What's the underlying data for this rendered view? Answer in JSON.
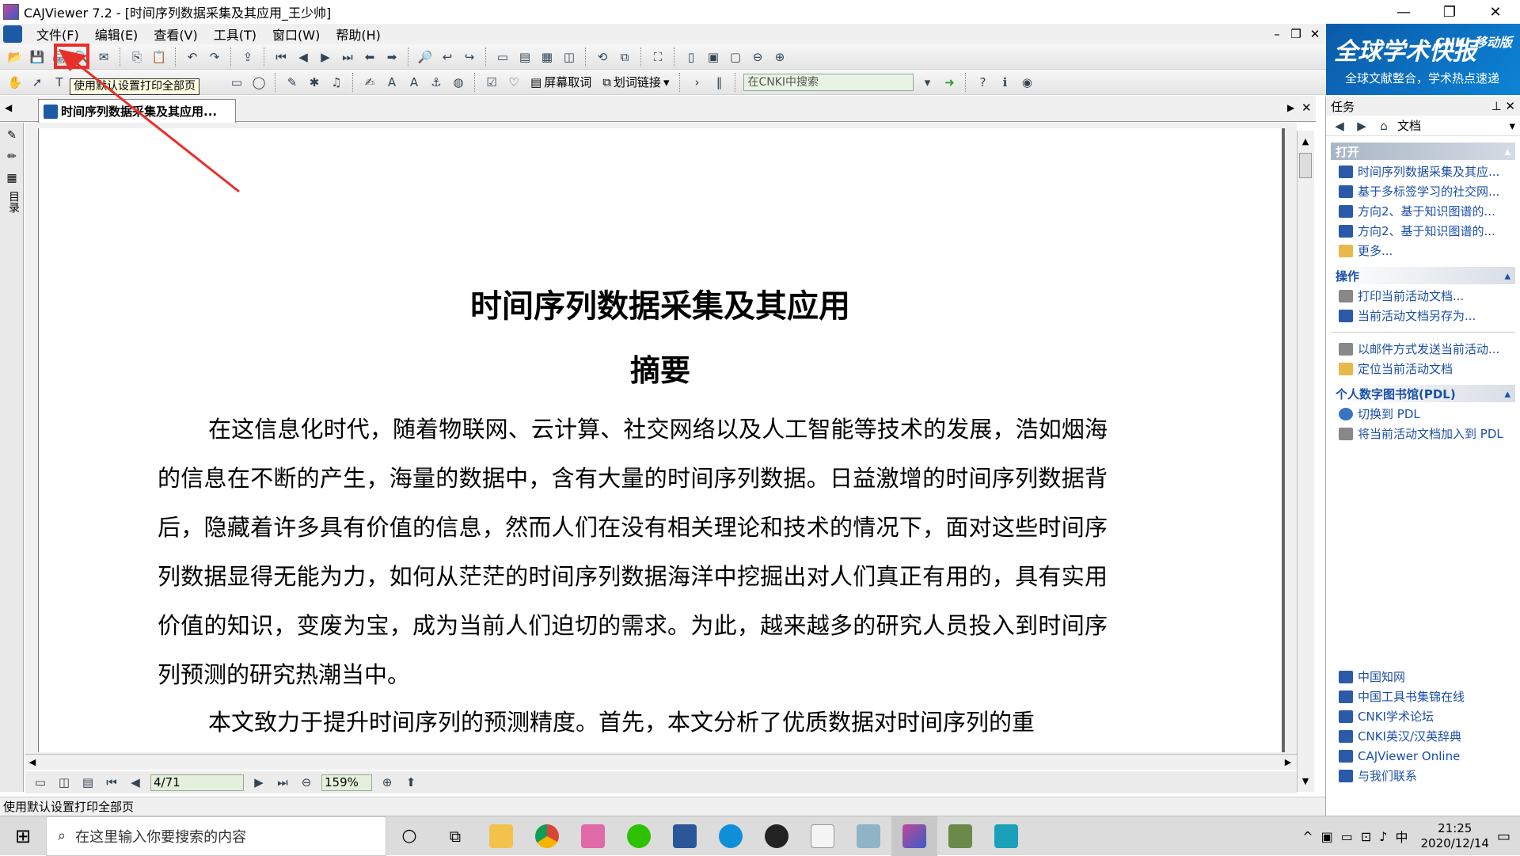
{
  "window": {
    "title": "CAJViewer 7.2 - [时间序列数据采集及其应用_王少帅]",
    "controls": {
      "minimize": "—",
      "restore": "❐",
      "close": "✕"
    }
  },
  "menu": [
    "文件(F)",
    "编辑(E)",
    "查看(V)",
    "工具(T)",
    "窗口(W)",
    "帮助(H)"
  ],
  "toolbar": {
    "tooltip": "使用默认设置打印全部页",
    "screen_select": "屏幕取词",
    "word_link": "划词链接",
    "search_placeholder": "在CNKI中搜索"
  },
  "tab": {
    "label": "时间序列数据采集及其应用..."
  },
  "left_panel": {
    "toc_label": "目录"
  },
  "document": {
    "title": "时间序列数据采集及其应用",
    "subtitle": "摘要",
    "paragraph1": "在这信息化时代，随着物联网、云计算、社交网络以及人工智能等技术的发展，浩如烟海的信息在不断的产生，海量的数据中，含有大量的时间序列数据。日益激增的时间序列数据背后，隐藏着许多具有价值的信息，然而人们在没有相关理论和技术的情况下，面对这些时间序列数据显得无能为力，如何从茫茫的时间序列数据海洋中挖掘出对人们真正有用的，具有实用价值的知识，变废为宝，成为当前人们迫切的需求。为此，越来越多的研究人员投入到时间序列预测的研究热潮当中。",
    "paragraph2": "本文致力于提升时间序列的预测精度。首先，本文分析了优质数据对时间序列的重"
  },
  "nav": {
    "page": "4/71",
    "zoom": "159%"
  },
  "status": {
    "text": "使用默认设置打印全部页"
  },
  "banner": {
    "title": "全球学术快报",
    "brand": "CNKI 移动版",
    "slogan": "全球文献整合，学术热点速递"
  },
  "task_pane": {
    "title": "任务",
    "nav_label": "文档",
    "sections": {
      "open": {
        "title": "打开",
        "items": [
          "时间序列数据采集及其应...",
          "基于多标签学习的社交网...",
          "方向2、基于知识图谱的...",
          "方向2、基于知识图谱的...",
          "更多..."
        ]
      },
      "ops": {
        "title": "操作",
        "items": [
          "打印当前活动文档...",
          "当前活动文档另存为...",
          "以邮件方式发送当前活动...",
          "定位当前活动文档"
        ]
      },
      "pdl": {
        "title": "个人数字图书馆(PDL)",
        "items": [
          "切换到 PDL",
          "将当前活动文档加入到 PDL"
        ]
      }
    },
    "links": [
      "中国知网",
      "中国工具书集锦在线",
      "CNKI学术论坛",
      "CNKI英汉/汉英辞典",
      "CAJViewer Online",
      "与我们联系"
    ]
  },
  "taskbar": {
    "search_placeholder": "在这里输入你要搜索的内容",
    "time": "21:25",
    "date": "2020/12/14",
    "ime": "中"
  },
  "colors": {
    "highlight": "#e8302a",
    "link": "#1c4fa8",
    "banner": "#0a5aa8"
  }
}
